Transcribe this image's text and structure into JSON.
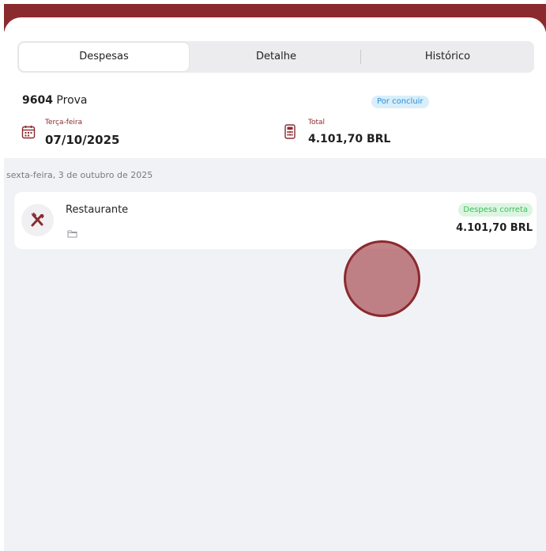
{
  "tabs": [
    {
      "label": "Despesas"
    },
    {
      "label": "Detalhe"
    },
    {
      "label": "Histórico"
    }
  ],
  "report": {
    "code": "9604",
    "name": "Prova",
    "status": "Por concluir"
  },
  "date": {
    "caption": "Terça-feira",
    "value": "07/10/2025"
  },
  "total": {
    "caption": "Total",
    "value": "4.101,70 BRL"
  },
  "day_header": "sexta-feira, 3 de outubro de 2025",
  "expenses": [
    {
      "title": "Restaurante",
      "status": "Despesa correta",
      "amount": "4.101,70 BRL",
      "category_icon": "utensils-icon"
    }
  ],
  "colors": {
    "brand": "#8b2a2e",
    "pending_badge": "#d8eefb",
    "ok_badge": "#dcf5e1",
    "list_bg": "#f1f2f6"
  }
}
